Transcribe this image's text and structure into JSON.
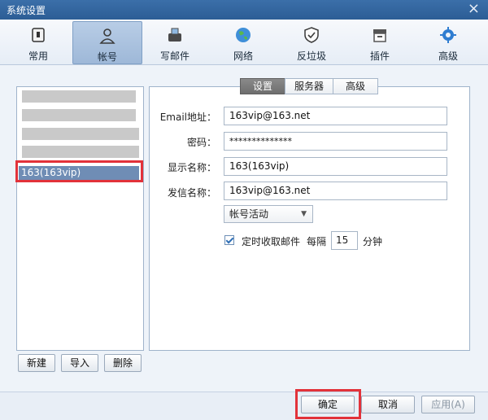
{
  "window": {
    "title": "系统设置",
    "close_label": "×"
  },
  "toolbar": {
    "items": [
      {
        "label": "常用",
        "icon": "general-icon"
      },
      {
        "label": "帐号",
        "icon": "user-icon"
      },
      {
        "label": "写邮件",
        "icon": "write-mail-icon"
      },
      {
        "label": "网络",
        "icon": "globe-icon"
      },
      {
        "label": "反垃圾",
        "icon": "shield-icon"
      },
      {
        "label": "插件",
        "icon": "plugin-icon"
      },
      {
        "label": "高级",
        "icon": "gear-icon"
      }
    ],
    "active_index": 1
  },
  "accounts": {
    "selected": "163(163vip)"
  },
  "left_buttons": {
    "new": "新建",
    "import": "导入",
    "delete": "删除"
  },
  "tabs": [
    {
      "label": "设置"
    },
    {
      "label": "服务器"
    },
    {
      "label": "高级"
    }
  ],
  "form": {
    "email_label": "Email地址：",
    "email_value": "163vip@163.net",
    "password_label": "密码：",
    "password_value": "**************",
    "display_label": "显示名称：",
    "display_value": "163(163vip)",
    "sender_label": "发信名称：",
    "sender_value": "163vip@163.net",
    "status_select": "帐号活动",
    "auto_fetch_label": "定时收取邮件",
    "interval_prefix": "每隔",
    "interval_value": "15",
    "interval_unit": "分钟"
  },
  "footer": {
    "ok": "确定",
    "cancel": "取消",
    "apply": "应用(A)"
  },
  "colors": {
    "highlight": "#e2323a",
    "selection": "#6f8db5",
    "title_bar": "#2c5d95"
  }
}
